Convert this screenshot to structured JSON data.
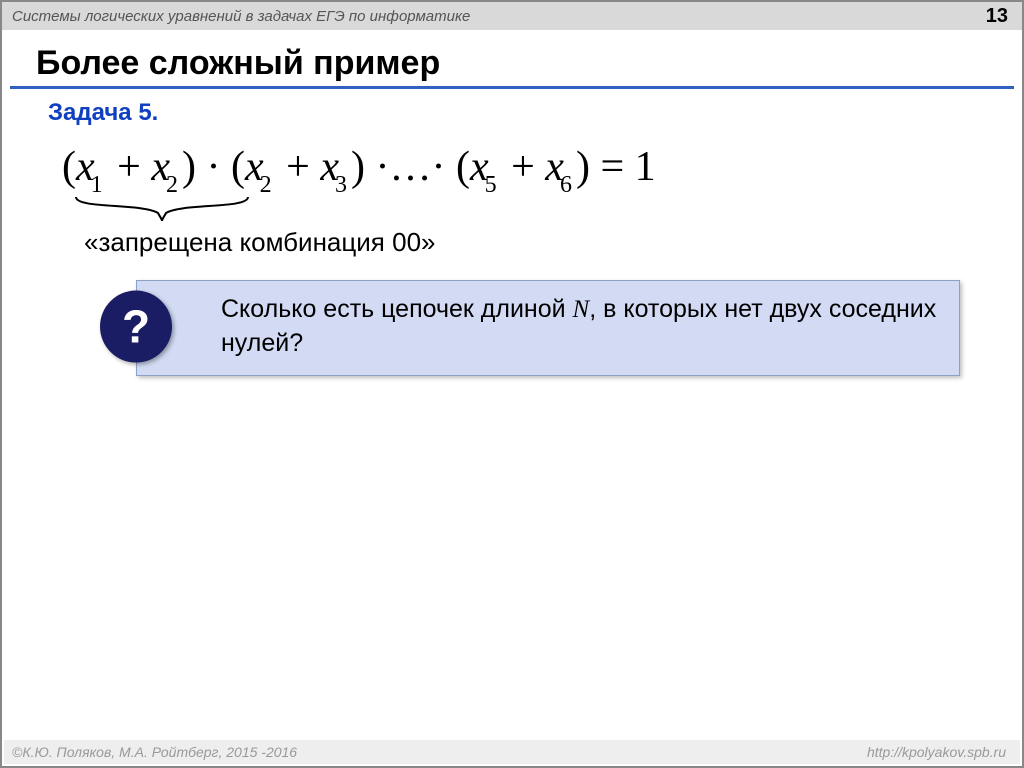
{
  "header": {
    "title": "Системы логических уравнений в задачах ЕГЭ по информатике",
    "page": "13"
  },
  "title": "Более сложный пример",
  "task_label": "Задача 5.",
  "formula": {
    "terms": [
      {
        "a": "x",
        "ai": "1",
        "b": "x",
        "bi": "2"
      },
      {
        "a": "x",
        "ai": "2",
        "b": "x",
        "bi": "3"
      },
      {
        "ellipsis": "…"
      },
      {
        "a": "x",
        "ai": "5",
        "b": "x",
        "bi": "6"
      }
    ],
    "eq": "= 1"
  },
  "note": "«запрещена комбинация 00»",
  "badge": "?",
  "callout_pre": "Сколько есть цепочек длиной ",
  "callout_var": "N",
  "callout_post": ", в которых нет двух соседних нулей?",
  "footer": {
    "copyright": "©К.Ю. Поляков, М.А. Ройтберг, 2015 -2016",
    "url": "http://kpolyakov.spb.ru"
  }
}
